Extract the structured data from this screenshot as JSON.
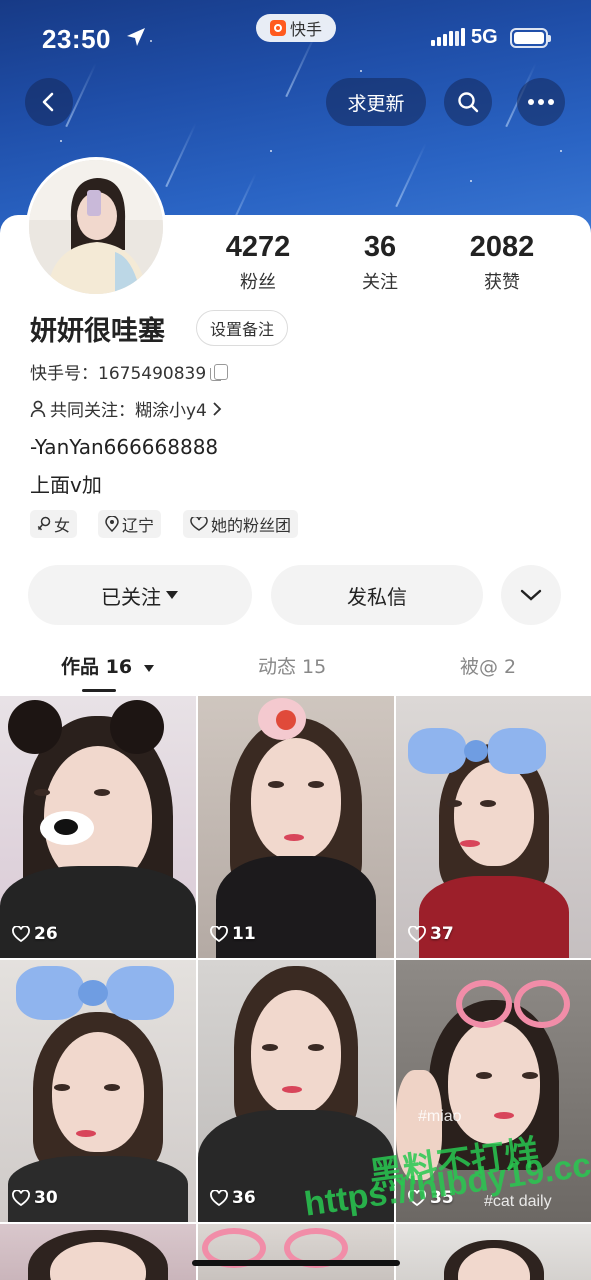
{
  "status_bar": {
    "time": "23:50",
    "app_pill_label": "快手",
    "network": "5G"
  },
  "header": {
    "update_button_label": "求更新"
  },
  "profile": {
    "nickname": "妍妍很哇塞",
    "remark_button_label": "设置备注",
    "kuaishou_id_label": "快手号：1675490839",
    "mutual_follow_label": "共同关注：糊涂小y4",
    "bio_line_1": "-YanYan666668888",
    "bio_line_2": "上面v加",
    "tags": {
      "gender": "女",
      "location": "辽宁",
      "fan_group": "她的粉丝团"
    }
  },
  "stats": {
    "fans": {
      "value": "4272",
      "label": "粉丝"
    },
    "following": {
      "value": "36",
      "label": "关注"
    },
    "likes": {
      "value": "2082",
      "label": "获赞"
    }
  },
  "actions": {
    "followed_label": "已关注",
    "message_label": "发私信"
  },
  "tabs": {
    "works": "作品 16",
    "moments": "动态 15",
    "mentions": "被@ 2"
  },
  "videos": [
    {
      "likes": "26"
    },
    {
      "likes": "11"
    },
    {
      "likes": "37"
    },
    {
      "likes": "30"
    },
    {
      "likes": "36"
    },
    {
      "likes": "35"
    }
  ],
  "overlays": {
    "miao": "#miao",
    "cat_daily": "#cat daily",
    "watermark_line_1": "黑料不打烊",
    "watermark_line_2": "https://hlbdy19.cc"
  },
  "icons": [
    "location-arrow-icon",
    "back-icon",
    "search-icon",
    "more-icon",
    "copy-icon",
    "person-icon",
    "chevron-right-icon",
    "gender-female-icon",
    "location-pin-icon",
    "fan-heart-icon",
    "triangle-down-icon",
    "chevron-down-icon",
    "heart-icon"
  ]
}
